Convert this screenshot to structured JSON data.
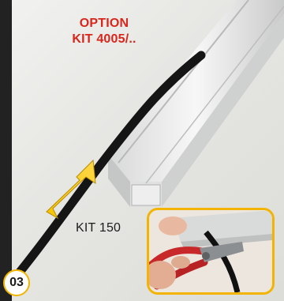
{
  "labels": {
    "option_line1": "OPTION",
    "option_line2": "KIT 4005/..",
    "kit": "KIT 150",
    "step_number": "03"
  },
  "colors": {
    "option_text": "#d9261c",
    "accent_yellow": "#f2b400",
    "profile_aluminium": "#e9eaea",
    "cable": "#151515",
    "pliers_handle": "#c8282a"
  },
  "icons": {
    "direction_arrow": "yellow-arrow-icon",
    "inset_tool": "cable-cutter-pliers"
  }
}
